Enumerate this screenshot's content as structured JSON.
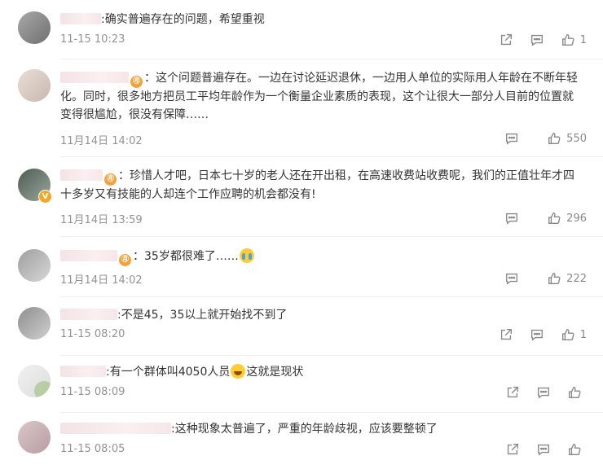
{
  "comments": [
    {
      "text_prefix": ":",
      "text": "确实普遍存在的问题，希望重视",
      "time": "11-15 10:23",
      "likes": "1",
      "has_share": true,
      "badge": false
    },
    {
      "text_prefix": "：",
      "text": "这个问题普遍存在。一边在讨论延迟退休，一边用人单位的实际用人年龄在不断年轻化。同时，很多地方把员工平均年龄作为一个衡量企业素质的表现，这个让很大一部分人目前的位置就变得很尴尬，很没有保障……",
      "time": "11月14日 14:02",
      "likes": "550",
      "has_share": false,
      "badge": true
    },
    {
      "text_prefix": "：",
      "text": "珍惜人才吧，日本七十岁的老人还在开出租，在高速收费站收费呢，我们的正值壮年才四十多岁又有技能的人却连个工作应聘的机会都没有!",
      "time": "11月14日 13:59",
      "likes": "296",
      "has_share": false,
      "badge": true
    },
    {
      "text_prefix": "：",
      "text": "35岁都很难了……",
      "time": "11月14日 14:02",
      "likes": "222",
      "has_share": false,
      "badge": true
    },
    {
      "text_prefix": ":",
      "text": "不是45，35以上就开始找不到了",
      "time": "11-15 08:20",
      "likes": "1",
      "has_share": true,
      "badge": false
    },
    {
      "text_prefix": ":",
      "text_a": "有一个群体叫4050人员",
      "text_b": "这就是现状",
      "time": "11-15 08:09",
      "likes": "",
      "has_share": true,
      "badge": false
    },
    {
      "text_prefix": ":",
      "text": "这种现象太普遍了，严重的年龄歧视，应该要整顿了",
      "time": "11-15 08:05",
      "likes": "",
      "has_share": true,
      "badge": false
    }
  ],
  "icons": {
    "share": "share-icon",
    "reply": "comment-icon",
    "like": "thumbs-up-icon",
    "badge": "fan-badge-icon",
    "verified": "verified-v-icon"
  },
  "colors": {
    "text": "#333333",
    "meta": "#939393",
    "icon": "#888888",
    "badge": "#f3a23a"
  }
}
